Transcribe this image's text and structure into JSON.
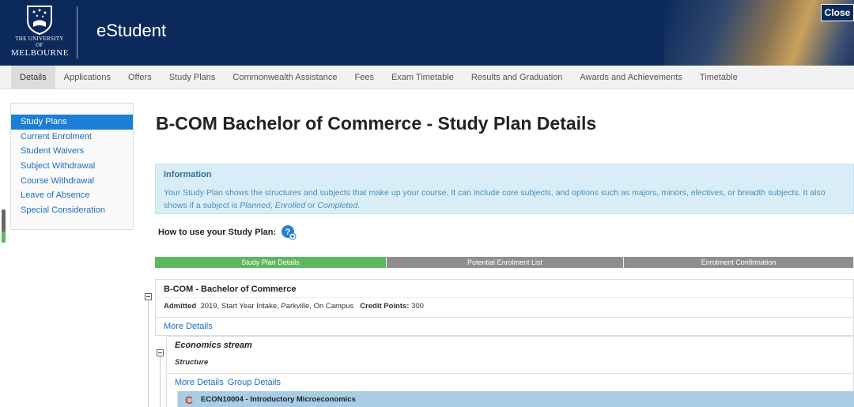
{
  "header": {
    "logo_line1": "THE UNIVERSITY OF",
    "logo_line2": "MELBOURNE",
    "app_title": "eStudent",
    "close_label": "Close"
  },
  "nav": {
    "items": [
      "Details",
      "Applications",
      "Offers",
      "Study Plans",
      "Commonwealth Assistance",
      "Fees",
      "Exam Timetable",
      "Results and Graduation",
      "Awards and Achievements",
      "Timetable"
    ],
    "active": "Details"
  },
  "sidebar": {
    "items": [
      "Study Plans",
      "Current Enrolment",
      "Student Waivers",
      "Subject Withdrawal",
      "Course Withdrawal",
      "Leave of Absence",
      "Special Consideration"
    ],
    "active": "Study Plans"
  },
  "main": {
    "page_title": "B-COM Bachelor of Commerce - Study Plan Details",
    "info": {
      "heading": "Information",
      "body_pre": "Your Study Plan shows the structures and subjects that make up your course. It can include core subjects, and options such as majors, minors, electives, or breadth subjects. It also shows if a subject is ",
      "planned": "Planned",
      "sep1": ", ",
      "enrolled": "Enrolled",
      "sep2": " or ",
      "completed": "Completed",
      "end": "."
    },
    "howto_label": "How to use your Study Plan:",
    "steps": [
      "Study Plan Details",
      "Potential Enrolment List",
      "Enrolment Confirmation"
    ],
    "course": {
      "title": "B-COM - Bachelor of Commerce",
      "admitted_label": "Admitted",
      "admitted_value": "2019, Start Year Intake, Parkville, On Campus",
      "credit_label": "Credit Points:",
      "credit_value": "300",
      "more_details": "More Details"
    },
    "stream": {
      "title": "Economics stream",
      "structure": "Structure",
      "more_details": "More Details",
      "group_details": "Group Details"
    },
    "subject": {
      "name": "ECON10004 - Introductory Microeconomics",
      "status_letter": "C"
    }
  },
  "colors": {
    "header_bg": "#0b2a5b",
    "link": "#1c6eb7",
    "active_blue": "#1c7ed6",
    "step_active": "#5cb85c",
    "step_inactive": "#8e8e8e",
    "info_bg": "#d9edf7",
    "subject_bg": "#a9cde3",
    "completed_icon": "#e03a1e"
  }
}
